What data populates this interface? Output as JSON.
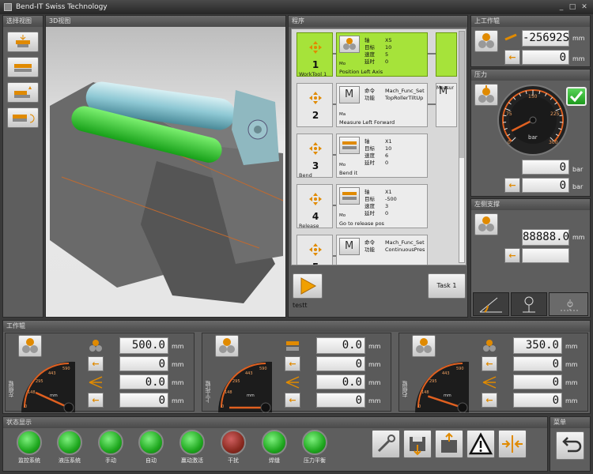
{
  "app": {
    "title": "Bend-IT Swiss Technology"
  },
  "panels": {
    "view_select": "选择视图",
    "view_3d": "3D视图",
    "program": "程序",
    "upper_roll": "上工作辊",
    "pressure": "压力",
    "left_support": "左侧支撑",
    "work_roll": "工作辊",
    "status": "状态显示",
    "menu": "菜单"
  },
  "program": {
    "steps": [
      {
        "num": "1",
        "label": "WorkTool 1",
        "row1": [
          "轴",
          "X5"
        ],
        "row2": [
          "目标",
          "10"
        ],
        "row3": [
          "速度",
          "5"
        ],
        "row4": [
          "延时",
          "0"
        ],
        "sub": "Mo",
        "caption": "Position Left Axis",
        "active": true
      },
      {
        "num": "2",
        "label": "",
        "row1": [
          "命令",
          "Mach_Func_Set"
        ],
        "row2": [
          "功能",
          "TopRollerTiltUp"
        ],
        "row3": [
          "",
          ""
        ],
        "row4": [
          "",
          ""
        ],
        "sub": "Ma",
        "caption": "Measure Left Forward",
        "caption2": "Measur"
      },
      {
        "num": "3",
        "label": "Bend",
        "row1": [
          "轴",
          "X1"
        ],
        "row2": [
          "目标",
          "10"
        ],
        "row3": [
          "速度",
          "6"
        ],
        "row4": [
          "延时",
          "0"
        ],
        "sub": "Mo",
        "caption": "Bend it"
      },
      {
        "num": "4",
        "label": "Release",
        "row1": [
          "轴",
          "X1"
        ],
        "row2": [
          "目标",
          "-500"
        ],
        "row3": [
          "速度",
          "3"
        ],
        "row4": [
          "延时",
          "0"
        ],
        "sub": "Mo",
        "caption": "Go to release pos"
      },
      {
        "num": "5",
        "label": "",
        "row1": [
          "命令",
          "Mach_Func_Set"
        ],
        "row2": [
          "功能",
          "ContinuousPres"
        ],
        "row3": [
          "",
          ""
        ],
        "row4": [
          "",
          ""
        ],
        "sub": "",
        "caption": ""
      }
    ],
    "name": "testt",
    "task_label": "Task 1"
  },
  "upper_roll": {
    "value": "-25692S",
    "value2": "0",
    "unit": "mm"
  },
  "pressure": {
    "gauge_unit": "bar",
    "ticks": [
      "0",
      "75",
      "150",
      "225",
      "300"
    ],
    "value1": "0",
    "value2": "0",
    "unit": "bar",
    "reading": 20
  },
  "left_support": {
    "value": "88888.0",
    "unit": "mm"
  },
  "work_rolls": [
    {
      "label": "左侧辊",
      "value": "500.0",
      "v2": "0",
      "v3": "0.0",
      "v4": "0",
      "unit": "mm",
      "ticks": [
        "0",
        "148",
        "295",
        "443",
        "590"
      ],
      "reading": 80
    },
    {
      "label": "上工作辊",
      "value": "0.0",
      "v2": "0",
      "v3": "0.0",
      "v4": "0",
      "unit": "mm",
      "ticks": [
        "0",
        "148",
        "295",
        "443",
        "590"
      ],
      "reading": 0
    },
    {
      "label": "右侧辊",
      "value": "350.0",
      "v2": "0",
      "v3": "0",
      "v4": "0",
      "unit": "mm",
      "ticks": [
        "0",
        "148",
        "295",
        "443",
        "590"
      ],
      "reading": 60
    }
  ],
  "status": [
    {
      "label": "监控系统",
      "state": "on"
    },
    {
      "label": "液压系统",
      "state": "on"
    },
    {
      "label": "手动",
      "state": "on"
    },
    {
      "label": "自动",
      "state": "on"
    },
    {
      "label": "赢动激活",
      "state": "on"
    },
    {
      "label": "干扰",
      "state": "off"
    },
    {
      "label": "焊缝",
      "state": "on"
    },
    {
      "label": "压力平衡",
      "state": "on"
    }
  ],
  "colors": {
    "accent_green": "#a6e33a",
    "led_green": "#1fa81f",
    "led_red": "#8a2a20",
    "needle": "#e06020"
  }
}
